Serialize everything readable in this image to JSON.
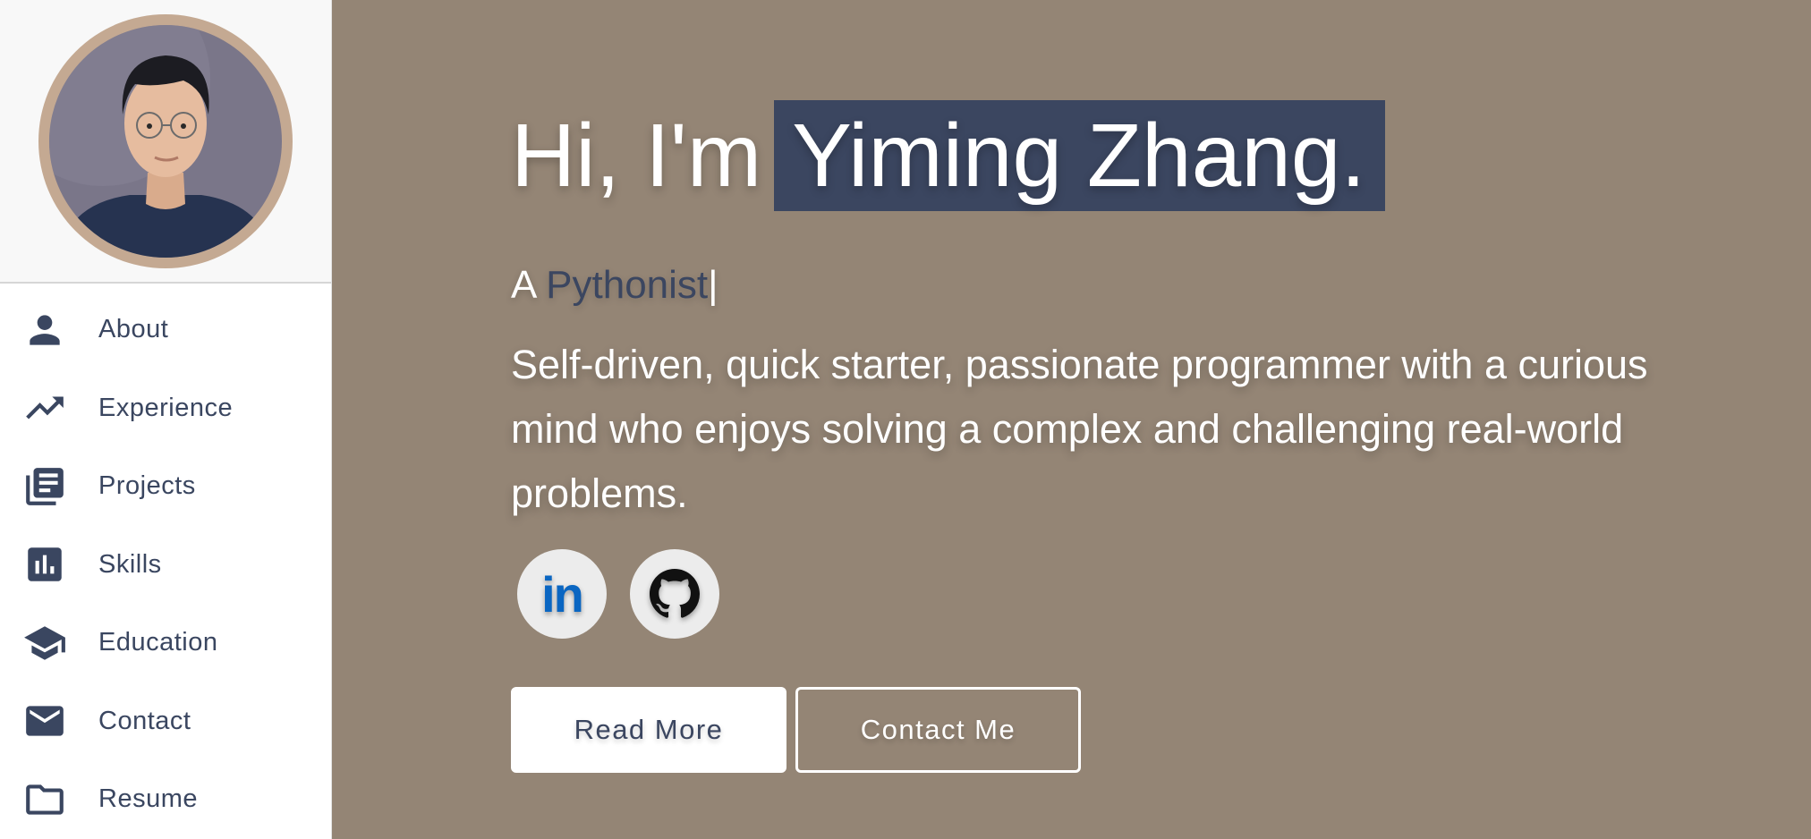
{
  "sidebar": {
    "items": [
      {
        "label": "About",
        "icon": "person-icon"
      },
      {
        "label": "Experience",
        "icon": "trending-up-icon"
      },
      {
        "label": "Projects",
        "icon": "library-books-icon"
      },
      {
        "label": "Skills",
        "icon": "bar-chart-icon"
      },
      {
        "label": "Education",
        "icon": "graduation-cap-icon"
      },
      {
        "label": "Contact",
        "icon": "mail-icon"
      },
      {
        "label": "Resume",
        "icon": "folder-icon"
      }
    ]
  },
  "hero": {
    "greeting_prefix": "Hi, I'm",
    "name": "Yiming Zhang.",
    "tagline_prefix": "A",
    "tagline_role": "Pythonist",
    "tagline_cursor": "|",
    "bio": "Self-driven, quick starter, passionate programmer with a curious mind who enjoys solving a complex and challenging real-world problems.",
    "socials": {
      "linkedin_text": "in"
    },
    "buttons": {
      "primary": "Read More",
      "secondary": "Contact Me"
    }
  },
  "colors": {
    "accent": "#3b4660",
    "background": "#948575",
    "avatar_ring": "#c4a992",
    "linkedin": "#0a66c2"
  }
}
